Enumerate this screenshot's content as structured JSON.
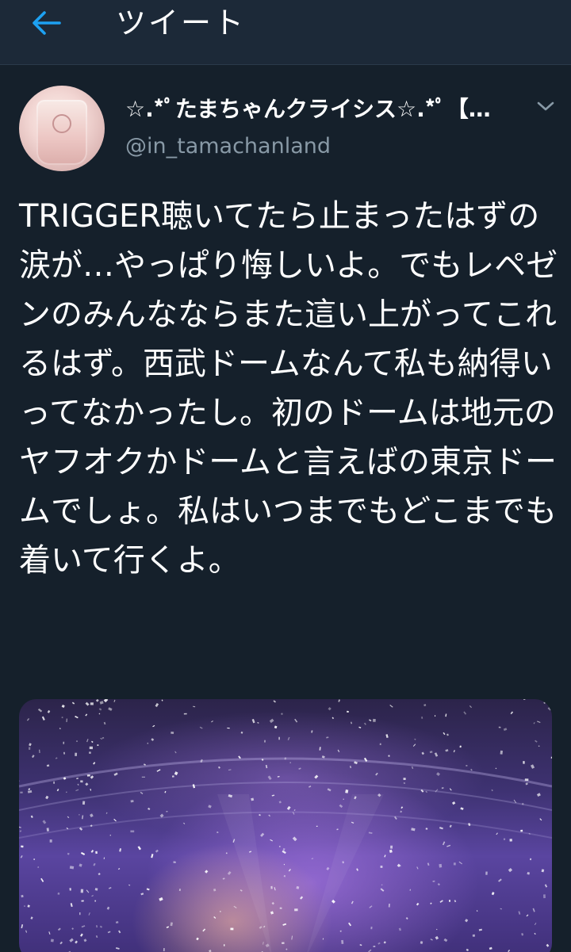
{
  "header": {
    "title": "ツイート",
    "back_icon": "arrow-left-icon",
    "accent": "#1da1f2"
  },
  "tweet": {
    "display_name": "☆.*ﾟたまちゃんクライシス☆.*ﾟ【…",
    "handle": "@in_tamachanland",
    "text": "TRIGGER聴いてたら止まったはずの涙が…やっぱり悔しいよ。でもレペゼンのみんなならまた這い上がってこれるはず。西武ドームなんて私も納得いってなかったし。初のドームは地元のヤフオクかドームと言えばの東京ドームでしょ。私はいつまでもどこまでも着いて行くよ。",
    "menu_icon": "chevron-down-icon",
    "media": {
      "type": "photo"
    }
  },
  "colors": {
    "background": "#15202b",
    "header_bg": "#1c2938",
    "text_primary": "#ffffff",
    "text_secondary": "#8899a6"
  }
}
